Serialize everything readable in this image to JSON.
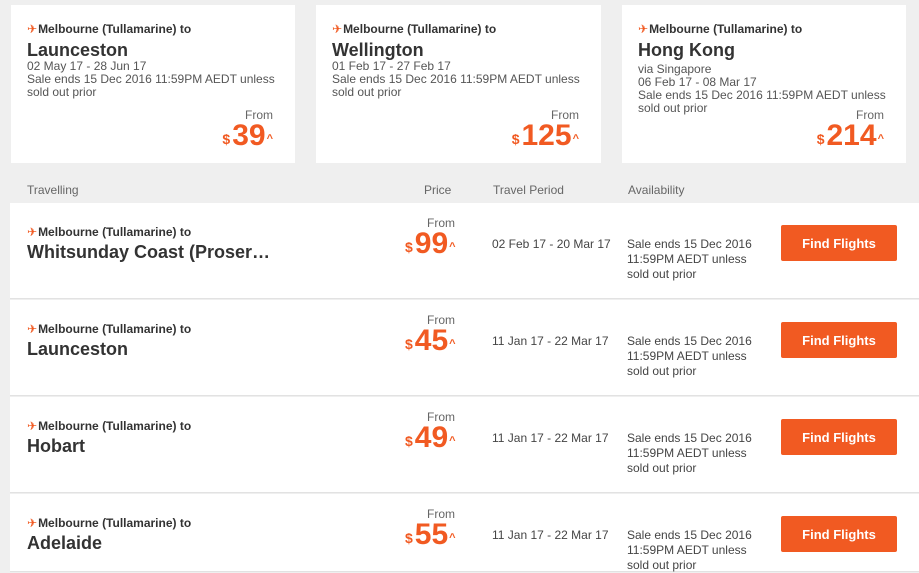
{
  "accent": "#f15a22",
  "icons": {
    "plane": "plane-icon"
  },
  "featured": [
    {
      "origin": "Melbourne (Tullamarine) to",
      "dest": "Launceston",
      "via": "",
      "dates": "02 May 17 - 28 Jun 17",
      "sale": "Sale ends 15 Dec 2016 11:59PM AEDT unless sold out prior",
      "from": "From",
      "currency": "$",
      "price": "39",
      "caret": "^"
    },
    {
      "origin": "Melbourne (Tullamarine) to",
      "dest": "Wellington",
      "via": "",
      "dates": "01 Feb 17 - 27 Feb 17",
      "sale": "Sale ends 15 Dec 2016 11:59PM AEDT unless sold out prior",
      "from": "From",
      "currency": "$",
      "price": "125",
      "caret": "^"
    },
    {
      "origin": "Melbourne (Tullamarine) to",
      "dest": "Hong Kong",
      "via": "via Singapore",
      "dates": "06 Feb 17 - 08 Mar 17",
      "sale": "Sale ends 15 Dec 2016 11:59PM AEDT unless sold out prior",
      "from": "From",
      "currency": "$",
      "price": "214",
      "caret": "^"
    }
  ],
  "table": {
    "headers": {
      "travelling": "Travelling",
      "price": "Price",
      "period": "Travel Period",
      "availability": "Availability"
    },
    "rows": [
      {
        "origin": "Melbourne (Tullamarine) to",
        "dest": "Whitsunday Coast (Proser…",
        "from": "From",
        "currency": "$",
        "price": "99",
        "caret": "^",
        "period": "02 Feb 17 - 20 Mar 17",
        "avail": "Sale ends 15 Dec 2016 11:59PM AEDT unless sold out prior",
        "button": "Find Flights"
      },
      {
        "origin": "Melbourne (Tullamarine) to",
        "dest": "Launceston",
        "from": "From",
        "currency": "$",
        "price": "45",
        "caret": "^",
        "period": "11 Jan 17 - 22 Mar 17",
        "avail": "Sale ends 15 Dec 2016 11:59PM AEDT unless sold out prior",
        "button": "Find Flights"
      },
      {
        "origin": "Melbourne (Tullamarine) to",
        "dest": "Hobart",
        "from": "From",
        "currency": "$",
        "price": "49",
        "caret": "^",
        "period": "11 Jan 17 - 22 Mar 17",
        "avail": "Sale ends 15 Dec 2016 11:59PM AEDT unless sold out prior",
        "button": "Find Flights"
      },
      {
        "origin": "Melbourne (Tullamarine) to",
        "dest": "Adelaide",
        "from": "From",
        "currency": "$",
        "price": "55",
        "caret": "^",
        "period": "11 Jan 17 - 22 Mar 17",
        "avail": "Sale ends 15 Dec 2016 11:59PM AEDT unless sold out prior",
        "button": "Find Flights"
      }
    ]
  }
}
